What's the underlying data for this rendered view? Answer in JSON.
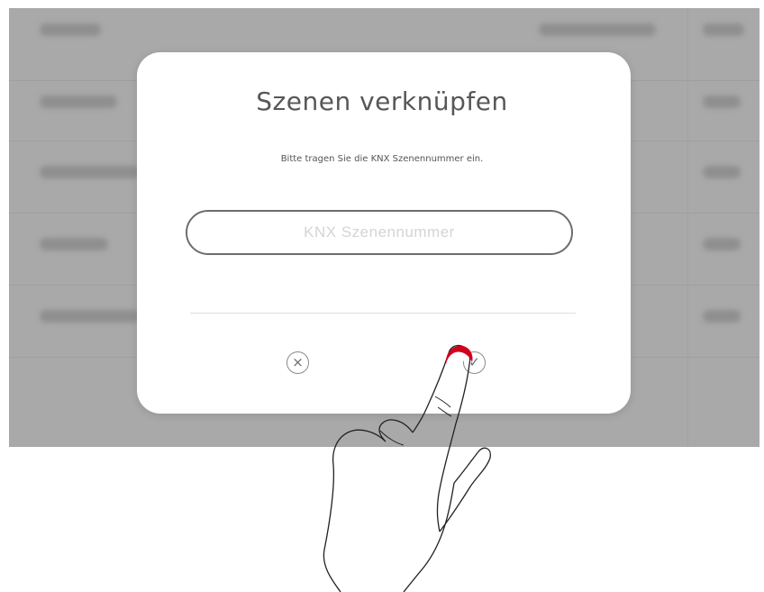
{
  "dialog": {
    "title": "Szenen verknüpfen",
    "subtitle": "Bitte tragen Sie die KNX Szenennummer ein.",
    "input_placeholder": "KNX Szenennummer",
    "input_value": "",
    "cancel_icon": "close-circle-icon",
    "confirm_icon": "check-circle-icon",
    "cancel_glyph": "×",
    "confirm_glyph": "✓"
  },
  "gesture": {
    "icon": "hand-tap-icon",
    "touch_color": "#d0021b"
  }
}
